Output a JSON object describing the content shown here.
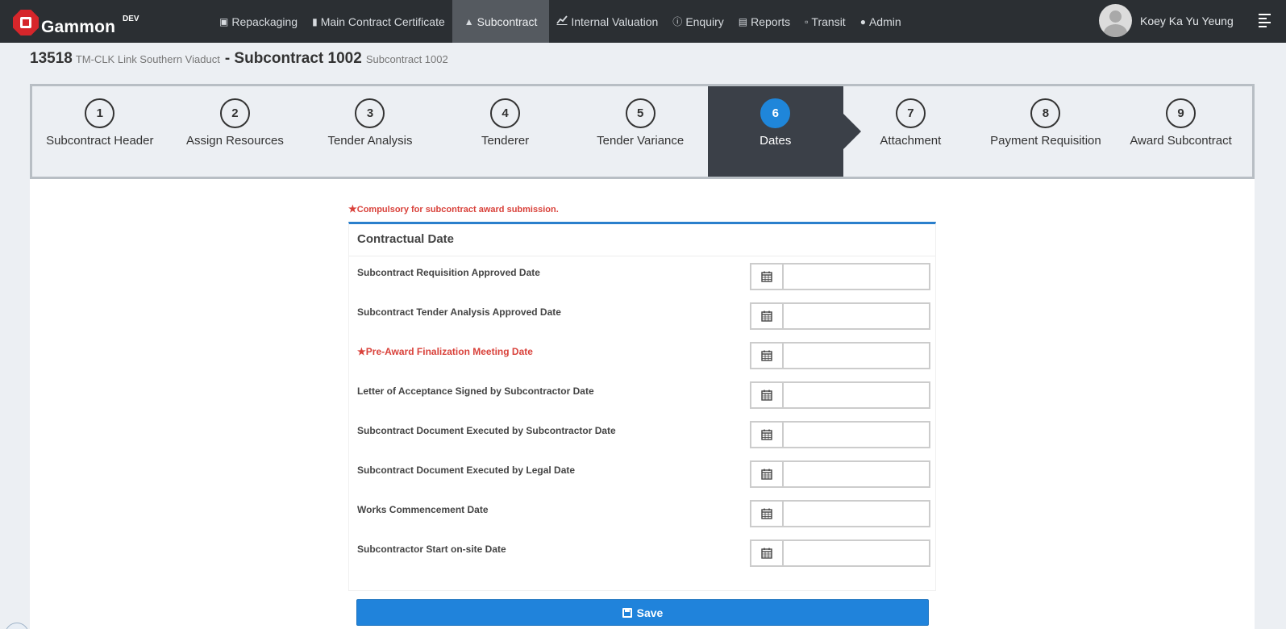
{
  "app": {
    "brand": "Gammon",
    "env": "DEV"
  },
  "nav": [
    {
      "icon": "cube-icon",
      "label": "Repackaging"
    },
    {
      "icon": "bookmark-icon",
      "label": "Main Contract Certificate"
    },
    {
      "icon": "trophy-icon",
      "label": "Subcontract"
    },
    {
      "icon": "line-chart-icon",
      "label": "Internal Valuation"
    },
    {
      "icon": "info-circle-icon",
      "label": "Enquiry"
    },
    {
      "icon": "book-icon",
      "label": "Reports"
    },
    {
      "icon": "file-icon",
      "label": "Transit"
    },
    {
      "icon": "user-icon",
      "label": "Admin"
    }
  ],
  "user": {
    "name": "Koey Ka Yu Yeung"
  },
  "header": {
    "job_no": "13518",
    "job_name": "TM-CLK Link Southern Viaduct",
    "subcontract_title": "- Subcontract 1002",
    "subcontract_desc": "Subcontract 1002"
  },
  "wizard": {
    "active_step": 6,
    "steps": [
      {
        "num": "1",
        "label": "Subcontract Header"
      },
      {
        "num": "2",
        "label": "Assign Resources"
      },
      {
        "num": "3",
        "label": "Tender Analysis"
      },
      {
        "num": "4",
        "label": "Tenderer"
      },
      {
        "num": "5",
        "label": "Tender Variance"
      },
      {
        "num": "6",
        "label": "Dates"
      },
      {
        "num": "7",
        "label": "Attachment"
      },
      {
        "num": "8",
        "label": "Payment Requisition"
      },
      {
        "num": "9",
        "label": "Award Subcontract"
      }
    ]
  },
  "form": {
    "note": "Compulsory for subcontract award submission.",
    "panel_title": "Contractual Date",
    "fields": [
      {
        "label": "Subcontract Requisition Approved Date",
        "value": "",
        "required": false
      },
      {
        "label": "Subcontract Tender Analysis Approved Date",
        "value": "",
        "required": false
      },
      {
        "label": "Pre-Award Finalization Meeting Date",
        "value": "",
        "required": true
      },
      {
        "label": "Letter of Acceptance Signed by Subcontractor Date",
        "value": "",
        "required": false
      },
      {
        "label": "Subcontract Document Executed by Subcontractor Date",
        "value": "",
        "required": false
      },
      {
        "label": "Subcontract Document Executed by Legal Date",
        "value": "",
        "required": false
      },
      {
        "label": "Works Commencement Date",
        "value": "",
        "required": false
      },
      {
        "label": "Subcontractor Start on-site Date",
        "value": "",
        "required": false
      }
    ],
    "save_label": "Save"
  },
  "colors": {
    "accent": "#2083db",
    "required": "#d9413a",
    "navbar": "#2b2f33",
    "active_step": "#3b4048"
  }
}
